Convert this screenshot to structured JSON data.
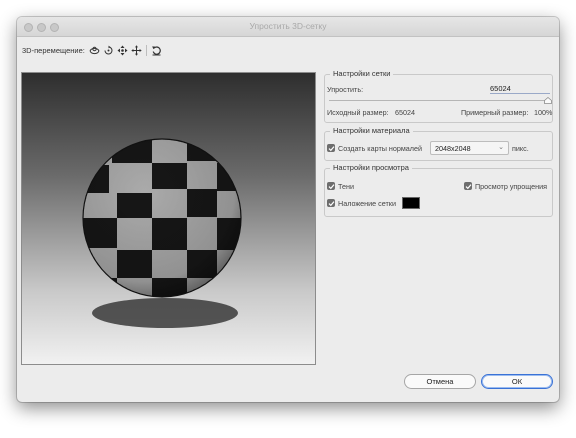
{
  "window": {
    "title": "Упростить 3D-сетку"
  },
  "toolbar": {
    "label": "3D-перемещение:",
    "icons": [
      "orbit-icon",
      "roll-icon",
      "pan-icon",
      "slide-icon",
      "reset-icon"
    ]
  },
  "mesh_settings": {
    "title": "Настройки сетки",
    "simplify_label": "Упростить:",
    "simplify_value": "65024",
    "slider_level": 1.0,
    "original_size_label": "Исходный размер:",
    "original_size_value": "65024",
    "approx_size_label": "Примерный размер:",
    "approx_size_value": "100%"
  },
  "material_settings": {
    "title": "Настройки материала",
    "normal_maps_label": "Создать карты нормалей",
    "normal_maps_checked": true,
    "resolution_value": "2048x2048",
    "units_label": "пикс."
  },
  "preview_settings": {
    "title": "Настройки просмотра",
    "shadows_label": "Тени",
    "shadows_checked": true,
    "simplify_preview_label": "Просмотр упрощения",
    "simplify_preview_checked": true,
    "mesh_overlay_label": "Наложение сетки",
    "mesh_overlay_checked": true,
    "overlay_color": "#000000"
  },
  "buttons": {
    "cancel_label": "Отмена",
    "ok_label": "ОК"
  }
}
